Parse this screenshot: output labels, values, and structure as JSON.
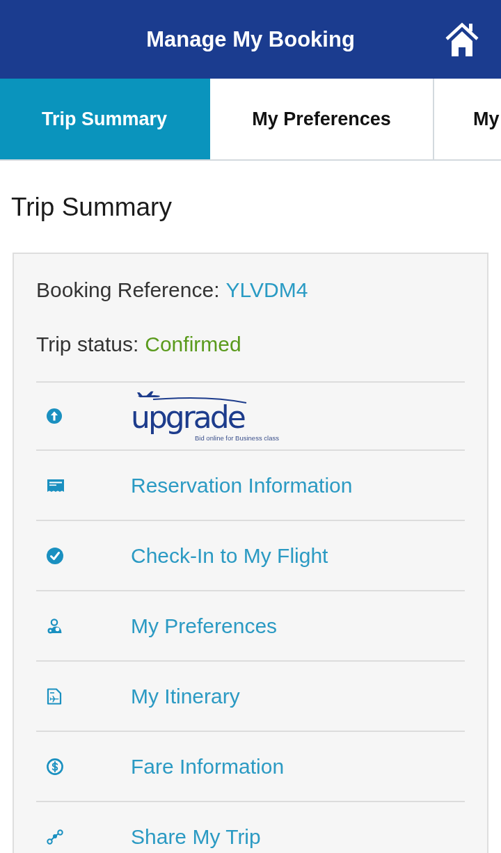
{
  "header": {
    "title": "Manage My Booking"
  },
  "tabs": [
    {
      "label": "Trip Summary",
      "selected": true
    },
    {
      "label": "My Preferences",
      "selected": false
    },
    {
      "label": "My",
      "selected": false
    }
  ],
  "page_title": "Trip Summary",
  "summary": {
    "booking_reference": {
      "label": "Booking Reference:",
      "value": "YLVDM4"
    },
    "trip_status": {
      "label": "Trip status:",
      "value": "Confirmed"
    }
  },
  "menu": [
    {
      "kind": "logo",
      "logo_text": "upgrade",
      "tagline": "Bid online for Business class"
    },
    {
      "kind": "link",
      "label": "Reservation Information"
    },
    {
      "kind": "link",
      "label": "Check-In to My Flight"
    },
    {
      "kind": "link",
      "label": "My Preferences"
    },
    {
      "kind": "link",
      "label": "My Itinerary"
    },
    {
      "kind": "link",
      "label": "Fare Information"
    },
    {
      "kind": "link",
      "label": "Share My Trip"
    }
  ]
}
